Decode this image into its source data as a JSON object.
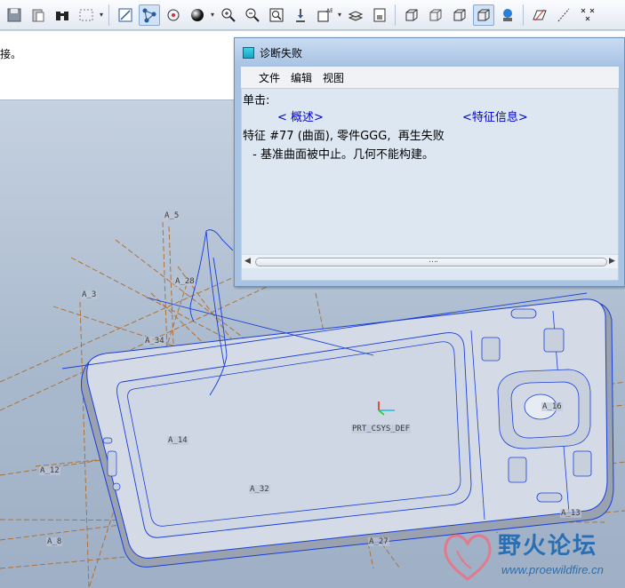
{
  "message_area": {
    "text": "接。"
  },
  "viewport": {
    "datum_labels": [
      "A_5",
      "A_28",
      "A_3",
      "A_34",
      "A_14",
      "PRT_CSYS_DEF",
      "A_32",
      "A_12",
      "A_8",
      "A_27",
      "A_13",
      "A_16"
    ]
  },
  "dialog": {
    "title": "诊断失败",
    "menu": [
      "文件",
      "编辑",
      "视图"
    ],
    "click_label": "单击:",
    "link_overview": "< 概述>",
    "link_feature_info": "<特征信息>",
    "line_feature": "特征 #77 (曲面), 零件GGG,  再生失败",
    "line_detail": " - 基准曲面被中止。几何不能构建。",
    "scroll_grip": "…."
  },
  "watermark": {
    "title": "野火论坛",
    "url": "www.proewildfire.cn"
  },
  "toolbar": {
    "icons": [
      "save-icon",
      "paste-icon",
      "binoculars-icon",
      "select-box-icon",
      "datum-display-icon",
      "spin-center-icon",
      "render-style-icon",
      "sphere-icon",
      "zoom-in-icon",
      "zoom-out-icon",
      "refit-icon",
      "orient-icon",
      "saved-views-icon",
      "layers-icon",
      "view-manager-icon",
      "wireframe-icon",
      "hidden-line-icon",
      "no-hidden-icon",
      "shading-icon",
      "appearance-icon",
      "datum-plane-icon",
      "datum-axis-icon",
      "datum-point-icon"
    ]
  },
  "colors": {
    "accent": "#2b6fb3",
    "model_edge": "#1a3ed8",
    "datum": "#b06a2a"
  }
}
